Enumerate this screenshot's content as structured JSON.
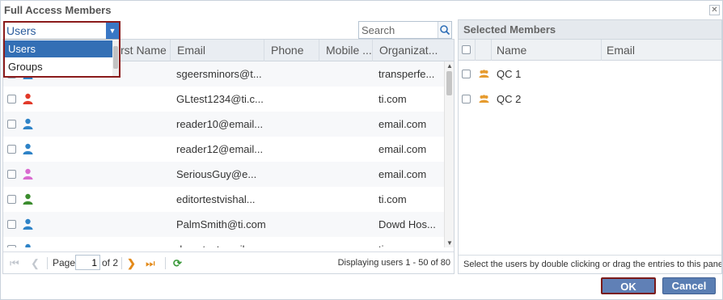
{
  "dialog": {
    "title": "Full Access Members",
    "close_glyph": "✕"
  },
  "type_combo": {
    "value": "Users",
    "options": [
      {
        "label": "Users",
        "selected": true
      },
      {
        "label": "Groups",
        "selected": false
      }
    ]
  },
  "search": {
    "placeholder": "Search",
    "icon": "search-icon"
  },
  "users_grid": {
    "columns": [
      "rst Name",
      "Email",
      "Phone",
      "Mobile ...",
      "Organizat..."
    ],
    "rows": [
      {
        "icon_color": "#2f83c7",
        "email": "sgeersminors@t...",
        "organization": "transperfe..."
      },
      {
        "icon_color": "#e23a2a",
        "email": "GLtest1234@ti.c...",
        "organization": "ti.com"
      },
      {
        "icon_color": "#2f83c7",
        "email": "reader10@email...",
        "organization": "email.com"
      },
      {
        "icon_color": "#2f83c7",
        "email": "reader12@email...",
        "organization": "email.com"
      },
      {
        "icon_color": "#d96bd0",
        "email": "SeriousGuy@e...",
        "organization": "email.com"
      },
      {
        "icon_color": "#3c8d2f",
        "email": "editortestvishal...",
        "organization": "ti.com"
      },
      {
        "icon_color": "#2f83c7",
        "email": "PalmSmith@ti.com",
        "organization": "Dowd Hos..."
      },
      {
        "icon_color": "#2f83c7",
        "email": "demotestemailus...",
        "organization": "ti.com"
      }
    ]
  },
  "paging": {
    "page_label": "Page",
    "current_page": "1",
    "of_label": "of 2",
    "display_text": "Displaying users 1 - 50 of 80"
  },
  "selected_panel": {
    "title": "Selected Members",
    "columns": [
      "Name",
      "Email"
    ],
    "rows": [
      {
        "name": "QC 1",
        "icon": "group-icon"
      },
      {
        "name": "QC 2",
        "icon": "group-icon"
      }
    ],
    "hint": "Select the users by double clicking or drag the entries to this pane."
  },
  "buttons": {
    "ok": "OK",
    "cancel": "Cancel"
  },
  "colors": {
    "accent": "#336fb5",
    "highlight_border": "#8b1b1b",
    "button": "#5a7eb3",
    "group_icon": "#e69b2e",
    "pager_next": "#e38a1a",
    "refresh": "#3b9a3b"
  }
}
